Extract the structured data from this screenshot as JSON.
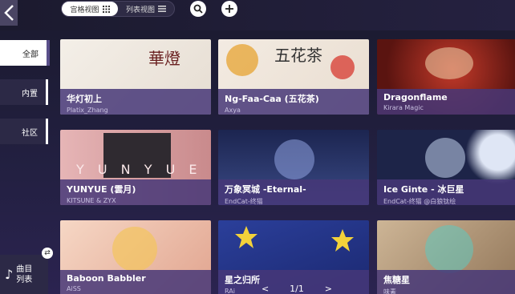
{
  "toolbar": {
    "grid_view_label": "宫格视图",
    "list_view_label": "列表视图"
  },
  "sidebar": {
    "tabs": [
      {
        "label": "全部",
        "active": true
      },
      {
        "label": "内置",
        "active": false
      },
      {
        "label": "社区",
        "active": false
      }
    ],
    "song_list_label_1": "曲目",
    "song_list_label_2": "列表"
  },
  "songs": [
    {
      "title": "华灯初上",
      "artist": "Platix_Zhang",
      "art_text": "華燈",
      "art_color": "#f1ece6"
    },
    {
      "title": "Ng-Faa-Caa (五花茶)",
      "artist": "Axya",
      "art_text": "五花茶",
      "art_color": "#efe6de"
    },
    {
      "title": "Dragonflame",
      "artist": "Kirara Magic",
      "art_text": "",
      "art_color": "#7a1e1a"
    },
    {
      "title": "YUNYUE (雲月)",
      "artist": "KITSUNE & ZYX",
      "art_text": "Y U N Y U E",
      "art_color": "#d9a7a8"
    },
    {
      "title": "万象冥城 -Eternal-",
      "artist": "EndCat-终猫",
      "art_text": "",
      "art_color": "#2a3560"
    },
    {
      "title": "Ice Ginte - 冰巨星",
      "artist": "EndCat-终猫 @白狼钛绘",
      "art_text": "",
      "art_color": "#1d2448"
    },
    {
      "title": "Baboon Babbler",
      "artist": "AiSS",
      "art_text": "",
      "art_color": "#e8b9a8"
    },
    {
      "title": "星之归所",
      "artist": "RAi",
      "art_text": "",
      "art_color": "#273a8a"
    },
    {
      "title": "焦糖星",
      "artist": "味素",
      "art_text": "",
      "art_color": "#b59a7a"
    }
  ],
  "pager": {
    "prev": "<",
    "page": "1/1",
    "next": ">"
  }
}
